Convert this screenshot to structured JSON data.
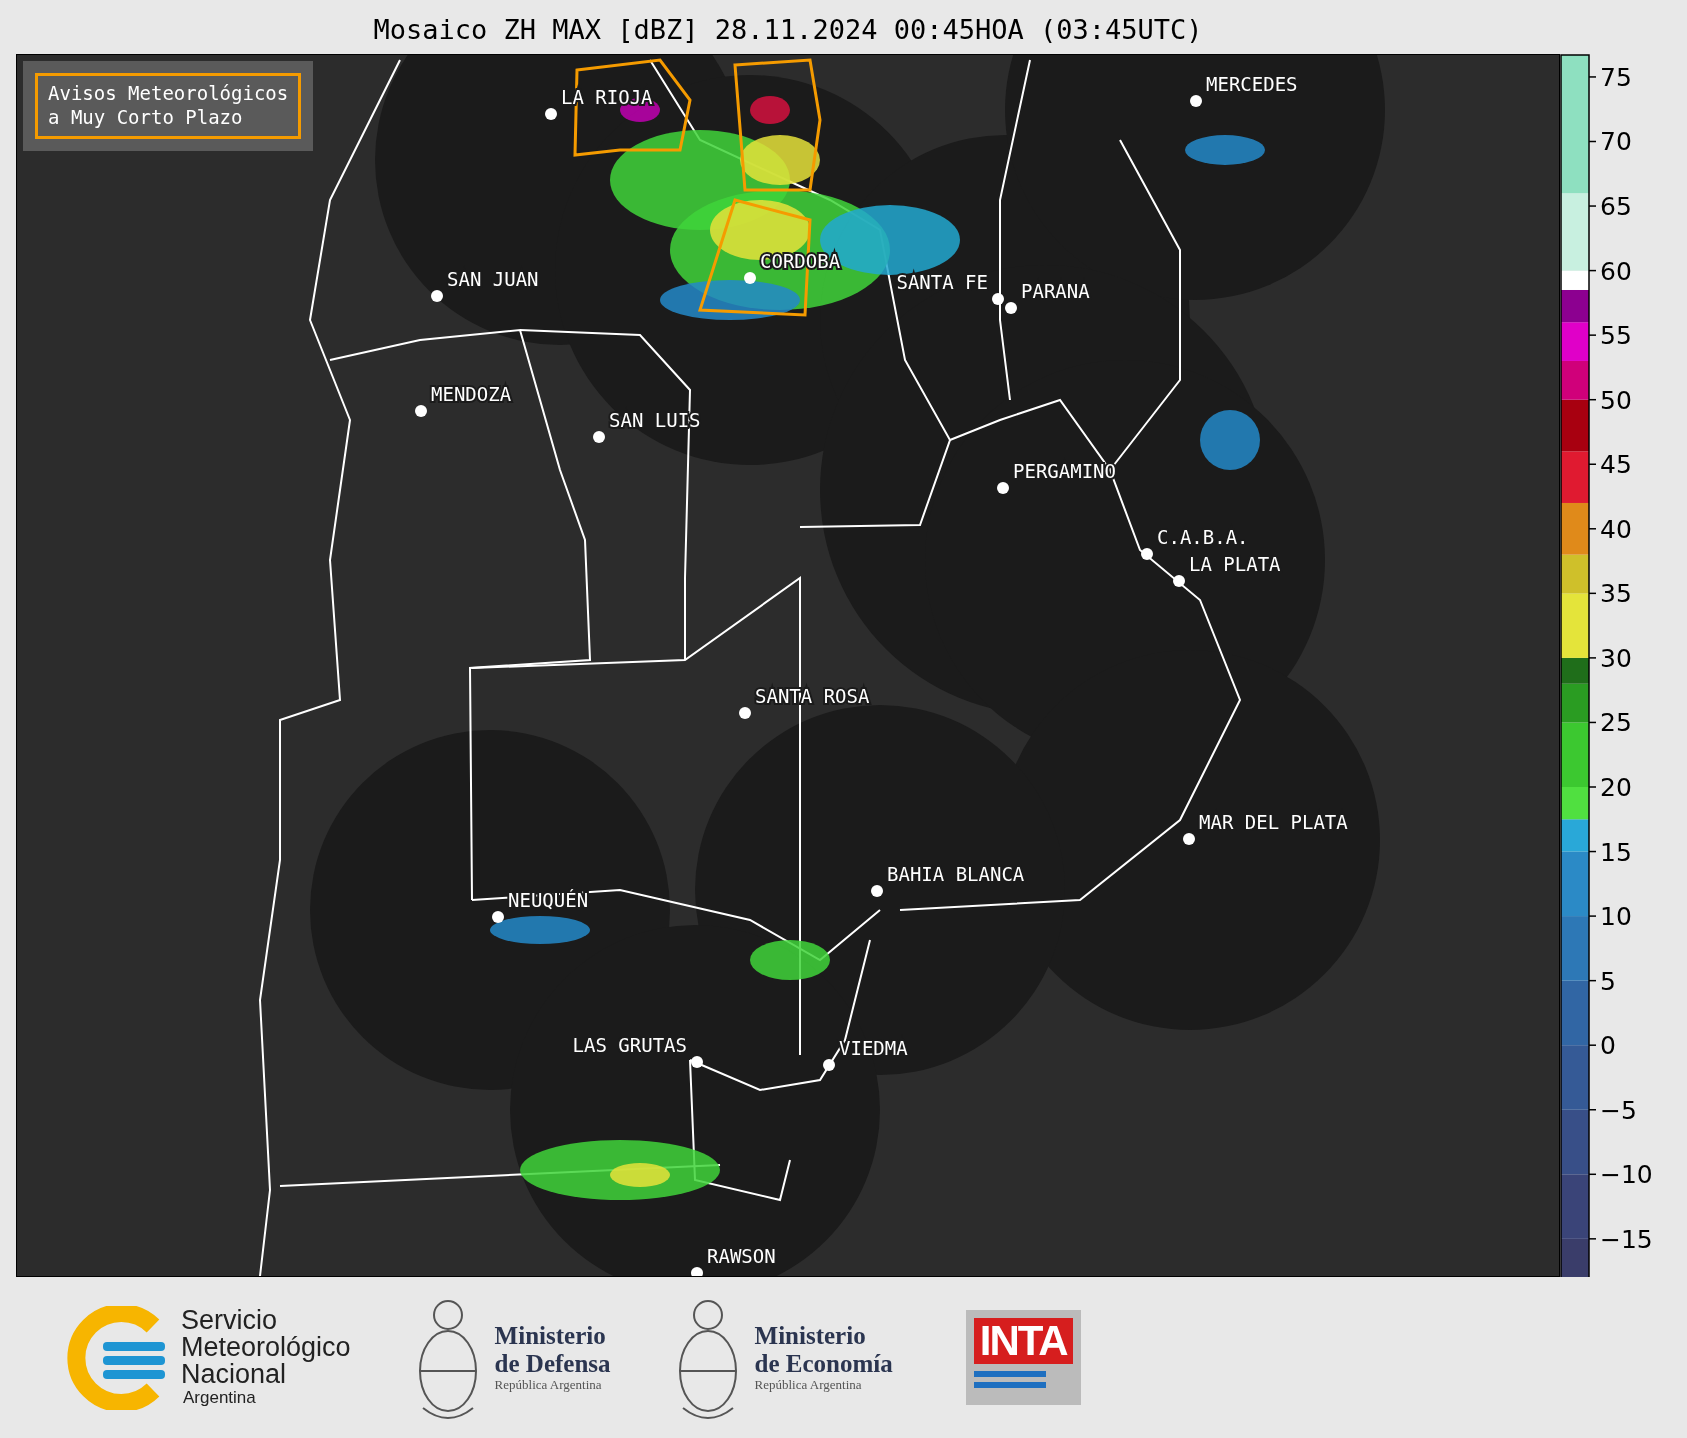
{
  "title": "Mosaico ZH MAX [dBZ] 28.11.2024 00:45HOA (03:45UTC)",
  "legend": {
    "text": "Avisos Meteorológicos\na Muy Corto Plazo"
  },
  "cities": [
    "LA RIOJA",
    "MERCEDES",
    "CORDOBA",
    "SAN JUAN",
    "SANTA FE",
    "PARANA",
    "MENDOZA",
    "SAN LUIS",
    "PERGAMINO",
    "C.A.B.A.",
    "LA PLATA",
    "SANTA ROSA",
    "MAR DEL PLATA",
    "BAHIA BLANCA",
    "NEUQUÉN",
    "LAS GRUTAS",
    "VIEDMA",
    "RAWSON"
  ],
  "colorbar": {
    "ticks": [
      "75",
      "70",
      "65",
      "60",
      "55",
      "50",
      "45",
      "40",
      "35",
      "30",
      "25",
      "20",
      "15",
      "10",
      "5",
      "0",
      "−5",
      "−10",
      "−15"
    ]
  },
  "footer": {
    "logos": [
      {
        "kind": "smn",
        "name": "Servicio\nMeteorológico\nNacional",
        "subtitle": "Argentina"
      },
      {
        "kind": "ministry",
        "name": "Ministerio\nde Defensa",
        "subtitle": "República Argentina"
      },
      {
        "kind": "ministry",
        "name": "Ministerio\nde Economía",
        "subtitle": "República Argentina"
      },
      {
        "kind": "inta",
        "name": "INTA"
      }
    ]
  }
}
